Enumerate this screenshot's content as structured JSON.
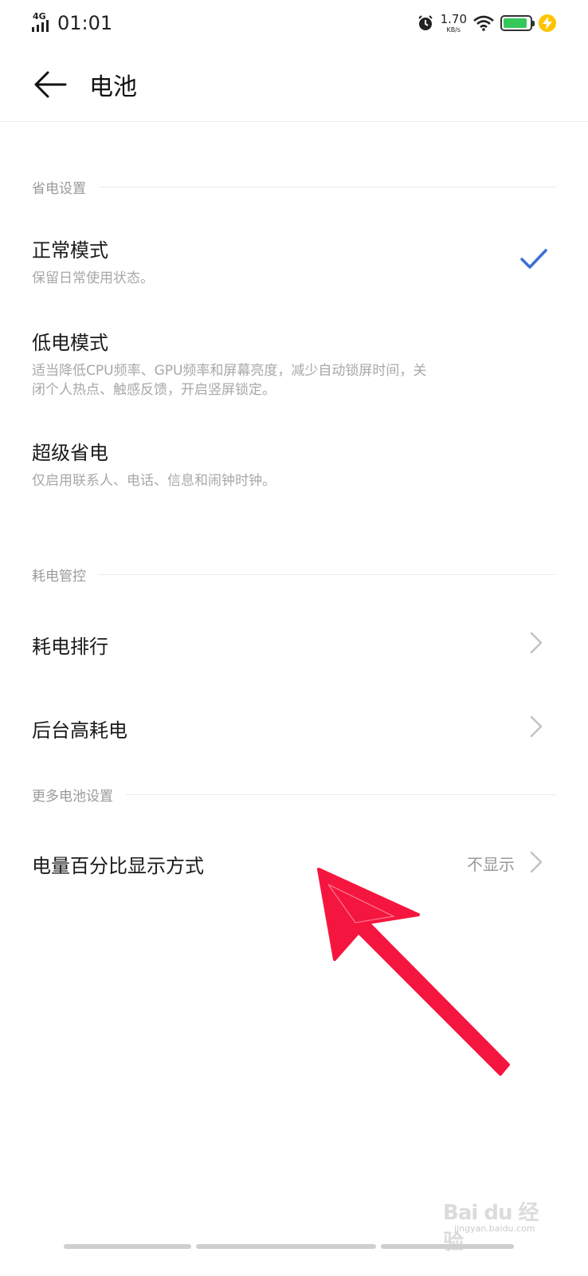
{
  "status_bar": {
    "network": "4G",
    "time": "01:01",
    "speed_value": "1.70",
    "speed_unit": "KB/s",
    "battery_level": 0.9,
    "battery_color": "#34c759",
    "icons": [
      "signal-icon",
      "alarm-icon",
      "wifi-icon",
      "battery-icon",
      "charging-icon"
    ]
  },
  "app_bar": {
    "title": "电池",
    "back_icon": "back-arrow-icon"
  },
  "sections": {
    "power_saving": {
      "header": "省电设置",
      "items": [
        {
          "title": "正常模式",
          "desc": "保留日常使用状态。",
          "selected": true
        },
        {
          "title": "低电模式",
          "desc_line1": "适当降低CPU频率、GPU频率和屏幕亮度，减少自动锁屏时间，关",
          "desc_line2": "闭个人热点、触感反馈，开启竖屏锁定。",
          "selected": false
        },
        {
          "title": "超级省电",
          "desc": "仅启用联系人、电话、信息和闹钟时钟。",
          "selected": false
        }
      ]
    },
    "consumption": {
      "header": "耗电管控",
      "items": [
        {
          "title": "耗电排行"
        },
        {
          "title": "后台高耗电"
        }
      ]
    },
    "more": {
      "header": "更多电池设置",
      "items": [
        {
          "title": "电量百分比显示方式",
          "value": "不显示"
        }
      ]
    }
  },
  "colors": {
    "accent": "#3a6fd8",
    "annotation_arrow": "#f5163f"
  },
  "watermark": {
    "main": "Bai du 经验",
    "sub": "jingyan.baidu.com"
  }
}
